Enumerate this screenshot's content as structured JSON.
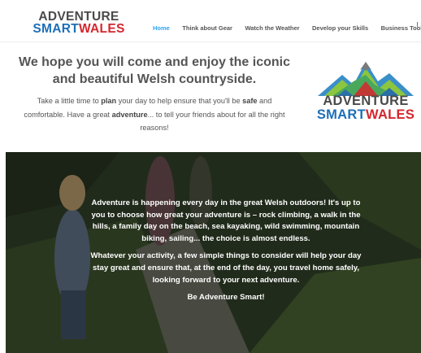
{
  "logo": {
    "line1": "ADVENTURE",
    "line2_a": "SMART",
    "line2_b": "WALES"
  },
  "nav": {
    "items": [
      {
        "label": "Home",
        "active": true
      },
      {
        "label": "Think about Gear",
        "active": false
      },
      {
        "label": "Watch the Weather",
        "active": false
      },
      {
        "label": "Develop your Skills",
        "active": false
      },
      {
        "label": "Business Toolkit",
        "active": false
      }
    ]
  },
  "intro": {
    "title": "We hope you will come and enjoy the iconic and beautiful Welsh countryside.",
    "p1": "Take a little time to ",
    "p1_bold1": "plan",
    "p2": " your day to help ensure that you'll be ",
    "p2_bold2": "safe",
    "p3": " and comfortable. Have a great ",
    "p3_bold3": "adventure",
    "p4": "... to tell your friends about for all the right reasons!"
  },
  "big_logo": {
    "line1": "ADVENTURE",
    "line2_a": "SMART",
    "line2_b": "WALES"
  },
  "hero": {
    "para1": "Adventure is happening every day in the great Welsh outdoors! It's up to you to choose how great your adventure is – rock climbing, a walk in the hills, a family day on the beach, sea kayaking, wild swimming, mountain biking, sailing... the choice is almost endless.",
    "para2": "Whatever your activity, a few simple things to consider will help your day stay great and ensure that, at the end of the day, you travel home safely, looking forward to your next adventure.",
    "para3": "Be Adventure Smart!"
  },
  "colors": {
    "accent_blue": "#1d6fb8",
    "accent_red": "#d6262d",
    "nav_active": "#2ea3f2",
    "logo_grey": "#4a4a4a"
  }
}
